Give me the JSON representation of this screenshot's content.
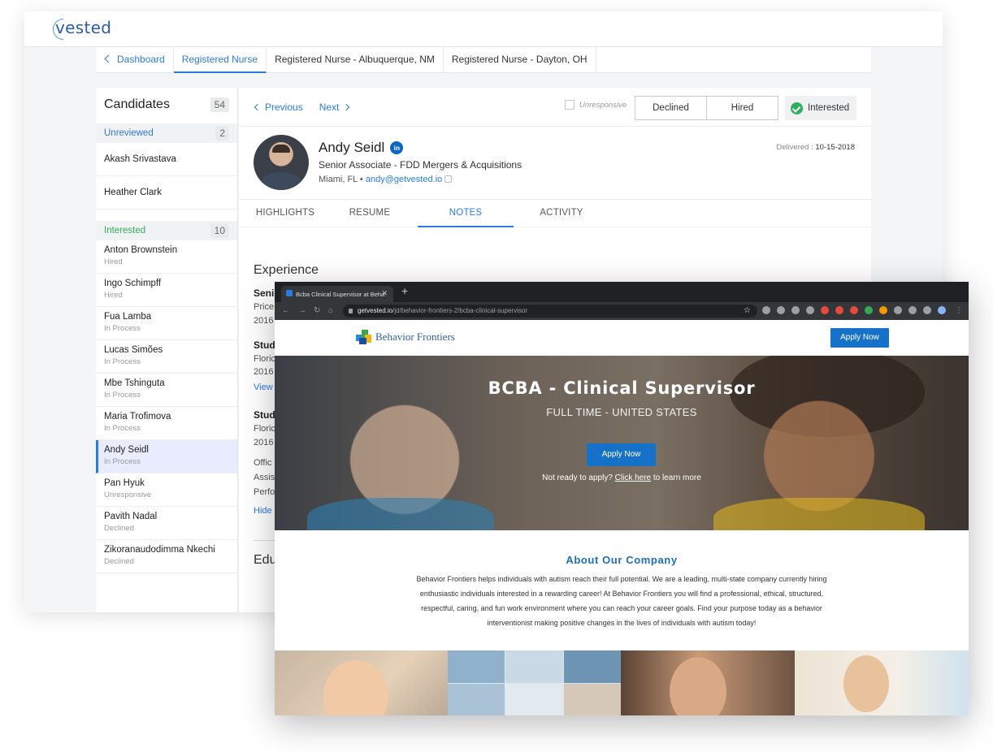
{
  "vested": {
    "logo": "vested",
    "tabs": {
      "back": "Dashboard",
      "items": [
        "Registered Nurse",
        "Registered Nurse - Albuquerque, NM",
        "Registered Nurse - Dayton, OH"
      ]
    },
    "sidebar": {
      "title": "Candidates",
      "total": "54",
      "groups": [
        {
          "label": "Unreviewed",
          "count": "2"
        },
        {
          "label": "Interested",
          "count": "10"
        }
      ],
      "unreviewed": [
        "Akash Srivastava",
        "Heather Clark"
      ],
      "candidates": [
        {
          "name": "Anton Brownstein",
          "status": "Hired"
        },
        {
          "name": "Ingo Schimpff",
          "status": "Hired"
        },
        {
          "name": "Fua Lamba",
          "status": "In Process"
        },
        {
          "name": "Lucas Simões",
          "status": "In Process"
        },
        {
          "name": "Mbe Tshinguta",
          "status": "In Process"
        },
        {
          "name": "Maria Trofimova",
          "status": "In Process"
        },
        {
          "name": "Andy Seidl",
          "status": "In Process"
        },
        {
          "name": "Pan Hyuk",
          "status": "Unresponsive"
        },
        {
          "name": "Pavith Nadal",
          "status": "Declined"
        },
        {
          "name": "Zikoranaudodimma Nkechi",
          "status": "Declined"
        }
      ]
    },
    "toolbar": {
      "previous": "Previous",
      "next": "Next",
      "unresponsive": "Unresponsive",
      "declined": "Declined",
      "hired": "Hired",
      "interested": "Interested"
    },
    "profile": {
      "name": "Andy Seidl",
      "linkedin": "in",
      "title": "Senior Associate - FDD Mergers & Acquisitions",
      "location": "Miami, FL • ",
      "email": "andy@getvested.io",
      "delivered_label": "Delivered : ",
      "delivered_date": "10-15-2018"
    },
    "profile_tabs": [
      "HIGHLIGHTS",
      "RESUME",
      "NOTES",
      "ACTIVITY"
    ],
    "experience": {
      "title": "Experience",
      "lines": [
        "Senio",
        "Price",
        "2016",
        "Stud",
        "Floric",
        "2016",
        "View",
        "Stud",
        "Floric",
        "2016",
        "Offic",
        "Assist",
        "Perfo",
        "Hide"
      ],
      "education": "Edu"
    }
  },
  "browser": {
    "tab_title": "Bcba Clinical Supervisor at Beha",
    "url_host": "getvested.io",
    "url_path": "/jd/behavior-frontiers-2/bcba-clinical-supervisor",
    "site": {
      "logo": "Behavior Frontiers",
      "apply_top": "Apply Now",
      "hero_title": "BCBA - Clinical Supervisor",
      "hero_sub": "FULL TIME - UNITED STATES",
      "apply_mid": "Apply Now",
      "note_pre": "Not ready to apply? ",
      "note_link": "Click here",
      "note_post": " to learn more",
      "about_title": "About Our Company",
      "about_body": "Behavior Frontiers helps individuals with autism reach their full potential.  We are a leading, multi-state company currently hiring enthusiastic individuals interested in a rewarding career!  At Behavior Frontiers you will find a professional, ethical, structured, respectful, caring, and fun work environment where you can reach your career goals.  Find your purpose today as a behavior interventionist making positive changes in the lives of individuals with autism today!"
    }
  },
  "colors": {
    "accent": "#2a7be4",
    "green": "#2fae5f",
    "bf_blue": "#1672c8"
  }
}
